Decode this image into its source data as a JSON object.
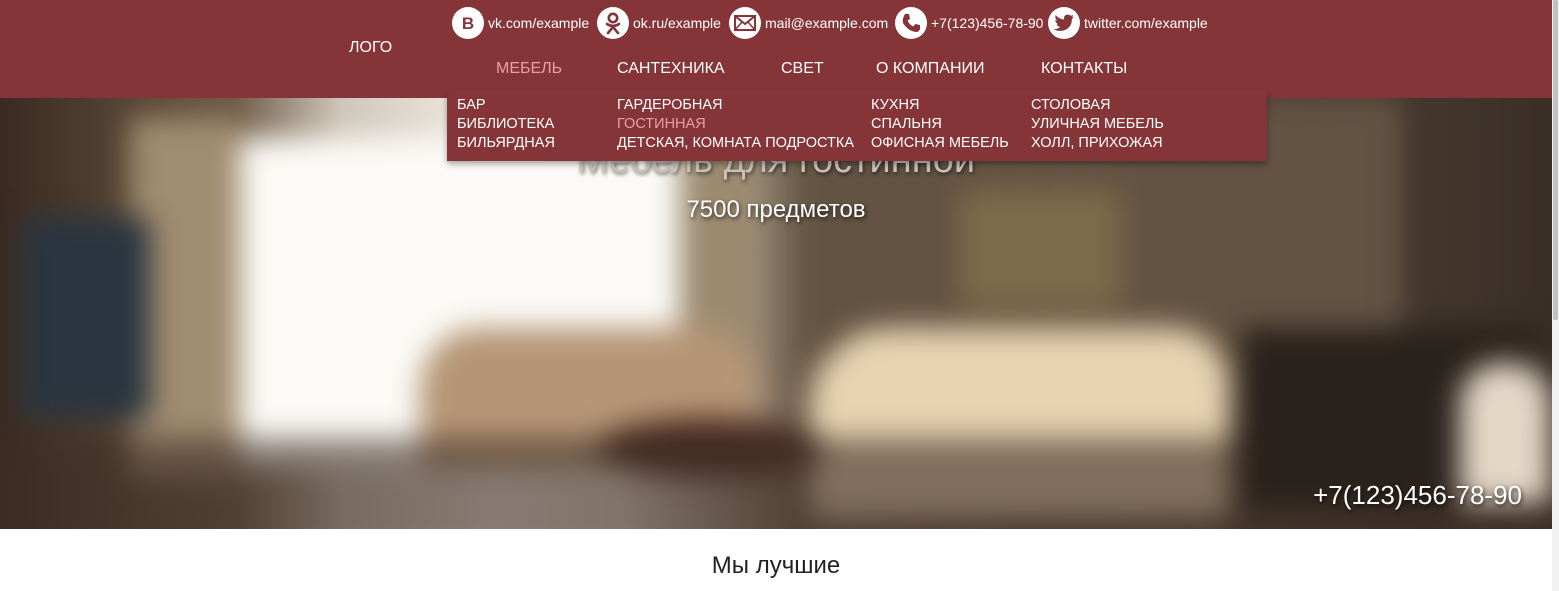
{
  "header": {
    "logo": "ЛОГО",
    "contacts": [
      {
        "icon": "vk-icon",
        "text": "vk.com/example"
      },
      {
        "icon": "odnoklassniki-icon",
        "text": "ok.ru/example"
      },
      {
        "icon": "mail-icon",
        "text": "mail@example.com"
      },
      {
        "icon": "phone-icon",
        "text": "+7(123)456-78-90"
      },
      {
        "icon": "twitter-icon",
        "text": "twitter.com/example"
      }
    ],
    "nav": [
      {
        "label": "МЕБЕЛЬ",
        "active": true
      },
      {
        "label": "САНТЕХНИКА"
      },
      {
        "label": "СВЕТ"
      },
      {
        "label": "О КОМПАНИИ"
      },
      {
        "label": "КОНТАКТЫ"
      }
    ]
  },
  "dropdown": {
    "columns": [
      [
        "БАР",
        "БИБЛИОТЕКА",
        "БИЛЬЯРДНАЯ"
      ],
      [
        "ГАРДЕРОБНАЯ",
        "ГОСТИННАЯ",
        "ДЕТСКАЯ, КОМНАТА ПОДРОСТКА"
      ],
      [
        "КУХНЯ",
        "СПАЛЬНЯ",
        "ОФИСНАЯ МЕБЕЛЬ"
      ],
      [
        "СТОЛОВАЯ",
        "УЛИЧНАЯ МЕБЕЛЬ",
        "ХОЛЛ, ПРИХОЖАЯ"
      ]
    ],
    "active_item": "ГОСТИННАЯ"
  },
  "hero": {
    "title": "Мебель для гостинной",
    "subtitle": "7500 предметов",
    "phone": "+7(123)456-78-90"
  },
  "section": {
    "title": "Мы лучшие"
  },
  "colors": {
    "brand": "#853538",
    "active_link": "#e7a0a2"
  }
}
